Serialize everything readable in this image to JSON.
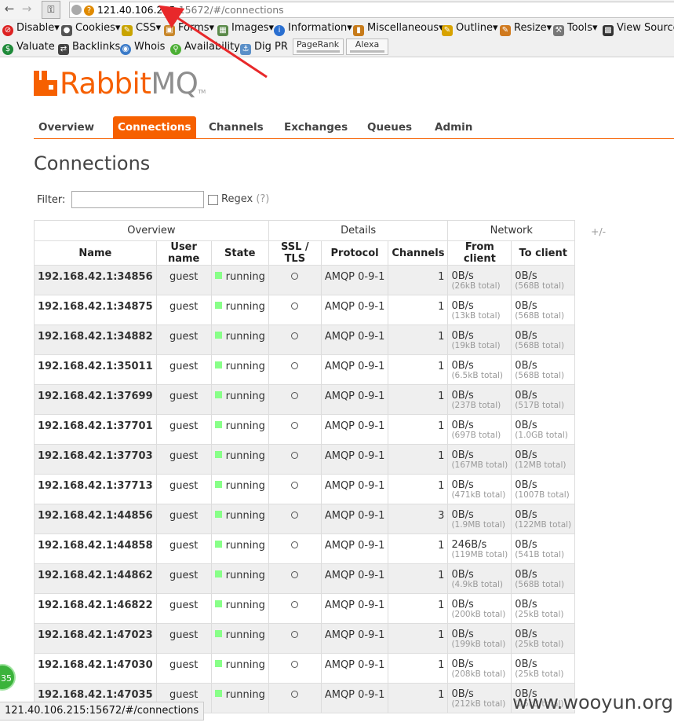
{
  "browser": {
    "url_host": "121.40.106.215",
    "url_rest": ":15672/#/connections",
    "status_url": "121.40.106.215:15672/#/connections"
  },
  "toolbar1": [
    "Disable",
    "Cookies",
    "CSS",
    "Forms",
    "Images",
    "Information",
    "Miscellaneous",
    "Outline",
    "Resize",
    "Tools",
    "View Source"
  ],
  "toolbar2": [
    "Valuate",
    "Backlinks",
    "Whois",
    "Availability",
    "Dig PR"
  ],
  "toolbar2_boxes": [
    "PageRank",
    "Alexa"
  ],
  "logo": {
    "rabbit": "Rabbit",
    "mq": "MQ",
    "tm": "TM"
  },
  "nav_tabs": [
    "Overview",
    "Connections",
    "Channels",
    "Exchanges",
    "Queues",
    "Admin"
  ],
  "active_tab": "Connections",
  "page_title": "Connections",
  "filter": {
    "label": "Filter:",
    "value": "",
    "regex_label": "Regex",
    "help": "(?)"
  },
  "table": {
    "groups": [
      "Overview",
      "Details",
      "Network"
    ],
    "headers": [
      "Name",
      "User name",
      "State",
      "SSL / TLS",
      "Protocol",
      "Channels",
      "From client",
      "To client"
    ],
    "plus_minus": "+/-",
    "rows": [
      {
        "name": "192.168.42.1:34856",
        "user": "guest",
        "state": "running",
        "protocol": "AMQP 0-9-1",
        "channels": "1",
        "from_rate": "0B/s",
        "from_total": "(26kB total)",
        "to_rate": "0B/s",
        "to_total": "(568B total)"
      },
      {
        "name": "192.168.42.1:34875",
        "user": "guest",
        "state": "running",
        "protocol": "AMQP 0-9-1",
        "channels": "1",
        "from_rate": "0B/s",
        "from_total": "(13kB total)",
        "to_rate": "0B/s",
        "to_total": "(568B total)"
      },
      {
        "name": "192.168.42.1:34882",
        "user": "guest",
        "state": "running",
        "protocol": "AMQP 0-9-1",
        "channels": "1",
        "from_rate": "0B/s",
        "from_total": "(19kB total)",
        "to_rate": "0B/s",
        "to_total": "(568B total)"
      },
      {
        "name": "192.168.42.1:35011",
        "user": "guest",
        "state": "running",
        "protocol": "AMQP 0-9-1",
        "channels": "1",
        "from_rate": "0B/s",
        "from_total": "(6.5kB total)",
        "to_rate": "0B/s",
        "to_total": "(568B total)"
      },
      {
        "name": "192.168.42.1:37699",
        "user": "guest",
        "state": "running",
        "protocol": "AMQP 0-9-1",
        "channels": "1",
        "from_rate": "0B/s",
        "from_total": "(237B total)",
        "to_rate": "0B/s",
        "to_total": "(517B total)"
      },
      {
        "name": "192.168.42.1:37701",
        "user": "guest",
        "state": "running",
        "protocol": "AMQP 0-9-1",
        "channels": "1",
        "from_rate": "0B/s",
        "from_total": "(697B total)",
        "to_rate": "0B/s",
        "to_total": "(1.0GB total)"
      },
      {
        "name": "192.168.42.1:37703",
        "user": "guest",
        "state": "running",
        "protocol": "AMQP 0-9-1",
        "channels": "1",
        "from_rate": "0B/s",
        "from_total": "(167MB total)",
        "to_rate": "0B/s",
        "to_total": "(12MB total)"
      },
      {
        "name": "192.168.42.1:37713",
        "user": "guest",
        "state": "running",
        "protocol": "AMQP 0-9-1",
        "channels": "1",
        "from_rate": "0B/s",
        "from_total": "(471kB total)",
        "to_rate": "0B/s",
        "to_total": "(1007B total)"
      },
      {
        "name": "192.168.42.1:44856",
        "user": "guest",
        "state": "running",
        "protocol": "AMQP 0-9-1",
        "channels": "3",
        "from_rate": "0B/s",
        "from_total": "(1.9MB total)",
        "to_rate": "0B/s",
        "to_total": "(122MB total)"
      },
      {
        "name": "192.168.42.1:44858",
        "user": "guest",
        "state": "running",
        "protocol": "AMQP 0-9-1",
        "channels": "1",
        "from_rate": "246B/s",
        "from_total": "(119MB total)",
        "to_rate": "0B/s",
        "to_total": "(541B total)"
      },
      {
        "name": "192.168.42.1:44862",
        "user": "guest",
        "state": "running",
        "protocol": "AMQP 0-9-1",
        "channels": "1",
        "from_rate": "0B/s",
        "from_total": "(4.9kB total)",
        "to_rate": "0B/s",
        "to_total": "(568B total)"
      },
      {
        "name": "192.168.42.1:46822",
        "user": "guest",
        "state": "running",
        "protocol": "AMQP 0-9-1",
        "channels": "1",
        "from_rate": "0B/s",
        "from_total": "(200kB total)",
        "to_rate": "0B/s",
        "to_total": "(25kB total)"
      },
      {
        "name": "192.168.42.1:47023",
        "user": "guest",
        "state": "running",
        "protocol": "AMQP 0-9-1",
        "channels": "1",
        "from_rate": "0B/s",
        "from_total": "(199kB total)",
        "to_rate": "0B/s",
        "to_total": "(25kB total)"
      },
      {
        "name": "192.168.42.1:47030",
        "user": "guest",
        "state": "running",
        "protocol": "AMQP 0-9-1",
        "channels": "1",
        "from_rate": "0B/s",
        "from_total": "(208kB total)",
        "to_rate": "0B/s",
        "to_total": "(25kB total)"
      },
      {
        "name": "192.168.42.1:47035",
        "user": "guest",
        "state": "running",
        "protocol": "AMQP 0-9-1",
        "channels": "1",
        "from_rate": "0B/s",
        "from_total": "(212kB total)",
        "to_rate": "0B/s",
        "to_total": "(25kB total)"
      }
    ]
  },
  "watermark": "www.wooyun.org",
  "badge": "35",
  "colors": {
    "accent": "#f66000",
    "running": "#88ff88",
    "annotation": "#e8282a"
  }
}
